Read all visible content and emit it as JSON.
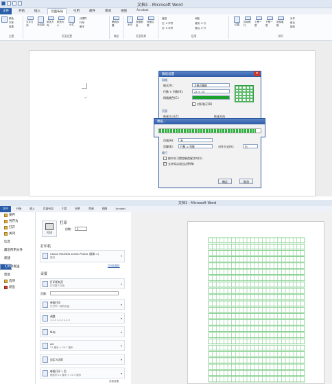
{
  "window1": {
    "title": "文档1 - Microsoft Word",
    "tabs": [
      "文件",
      "开始",
      "插入",
      "页面布局",
      "引用",
      "邮件",
      "审阅",
      "视图",
      "Acrobat"
    ],
    "ribbon": {
      "theme_items": [
        "颜色",
        "字体",
        "效果"
      ],
      "theme_label": "主题",
      "page_setup_buttons": [
        "文字方向",
        "页边距",
        "纸张方向",
        "纸张大小",
        "分栏"
      ],
      "page_setup_small": [
        "分隔符",
        "行号",
        "断字"
      ],
      "page_setup_label": "页面设置",
      "manuscript_button": "稿纸设置",
      "manuscript_label": "稿纸",
      "background_buttons": [
        "水印",
        "页面颜色",
        "页面边框"
      ],
      "background_label": "页面背景",
      "indent_label": "缩进",
      "spacing_label": "间距",
      "indent_left": "左: 0 字符",
      "indent_right": "右: 0 字符",
      "spacing_before": "段前: 0 行",
      "spacing_after": "段后: 0 行",
      "paragraph_label": "段落",
      "arrange_buttons": [
        "位置",
        "自动换行",
        "上移一层",
        "下移一层",
        "选择窗格"
      ],
      "arrange_small": [
        "对齐",
        "组合",
        "旋转"
      ],
      "arrange_label": "排列"
    },
    "dialog": {
      "title": "稿纸设置",
      "section_grid": "网格",
      "format_label": "格式(F):",
      "format_value": "方格式稿纸",
      "rowcol_label": "行数 × 列数(R):",
      "rowcol_value": "24 × 25",
      "gridcolor_label": "网格颜色(C):",
      "color_label": "",
      "flip_label": "对折装订(D)",
      "section_page": "页面",
      "papersize_label": "纸张大小(Z):",
      "orientation_label": "纸张方向",
      "pagenum_label": "页眉(H):",
      "pagenum_value": "无",
      "footer_label": "页脚(E):",
      "footer_value": "行数 × 列数",
      "align_label": "对齐方式(A):",
      "align_value": "右",
      "section_opts": "换行",
      "opt1": "按中文习惯控制首尾字符(U)",
      "opt2": "允许标点溢出边界(N)",
      "ok": "确定",
      "cancel": "取消"
    },
    "progress": {
      "title": "稿纸...",
      "fraction": 0.95
    }
  },
  "window2": {
    "title": "文档1 - Microsoft Word",
    "tabs": [
      "文件",
      "开始",
      "插入",
      "页面布局",
      "引用",
      "邮件",
      "审阅",
      "视图",
      "Acrobat"
    ],
    "sidebar": [
      "保存",
      "另存为",
      "打开",
      "关闭",
      "信息",
      "最近所用文件",
      "新建",
      "打印",
      "保存并发送",
      "帮助",
      "选项",
      "退出"
    ],
    "print": {
      "heading": "打印",
      "copies_label": "份数:",
      "copies_value": "1",
      "print_button": "打印",
      "printer_heading": "打印机",
      "printer_name": "Canon MG3500 series Printer (副本 1)",
      "printer_status": "脱机",
      "printer_props": "打印机属性",
      "settings_heading": "设置",
      "pages_label": "页数:",
      "pages_value": "",
      "settings_footer": "页面设置",
      "options": [
        {
          "title": "打印所有页",
          "sub": "打印整个文档"
        },
        {
          "title": "单面打印",
          "sub": "只打印一侧的页面"
        },
        {
          "title": "调整",
          "sub": "1,2,3  1,2,3  1,2,3"
        },
        {
          "title": "纵向",
          "sub": ""
        },
        {
          "title": "A4",
          "sub": "21 厘米 × 29.7 厘米"
        },
        {
          "title": "自定义边距",
          "sub": ""
        },
        {
          "title": "每版打印 1 页",
          "sub": "缩放到 14 厘米 × 20.3 厘米"
        }
      ]
    },
    "preview": {
      "rows": 24,
      "cols": 25,
      "grid_color": "#3fb24f"
    }
  },
  "colors": {
    "accent": "#2a5ea8",
    "grid_green": "#2b9a3e",
    "close_red": "#c8382c"
  }
}
